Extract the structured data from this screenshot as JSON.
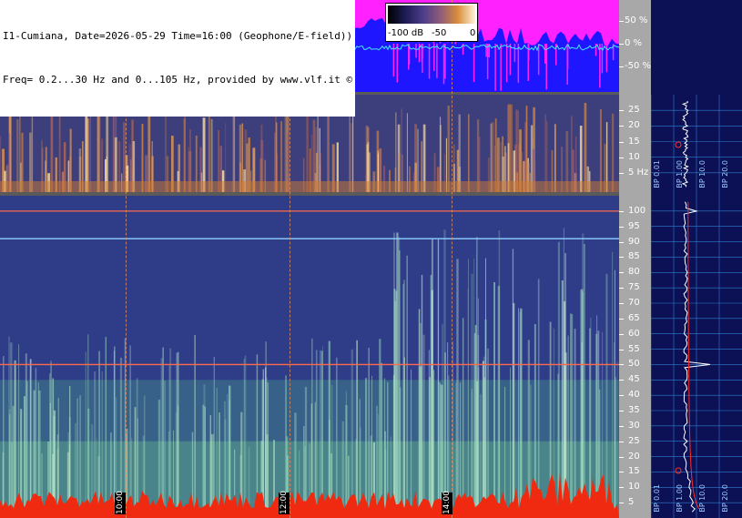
{
  "header": {
    "line1": "I1-Cumiana, Date=2026-05-29 Time=16:00 (Geophone/E-field))",
    "line2": "Freq= 0.2...30 Hz and 0...105 Hz, provided by www.vlf.it ©"
  },
  "colorbar": {
    "labels": [
      "-100 dB",
      "-50",
      "0"
    ]
  },
  "chart_data": [
    {
      "type": "line",
      "name": "waveform",
      "yticks": [
        "50 %",
        "0 %",
        "-50 %"
      ],
      "y_values": [
        50,
        0,
        -50
      ],
      "ylim": [
        -100,
        100
      ],
      "colors": {
        "background": "#1e16ff",
        "upper": "#ff22ff",
        "trace": "#46e6ff"
      }
    },
    {
      "type": "heatmap",
      "name": "low-frequency spectrogram",
      "yticks": [
        "25",
        "20",
        "15",
        "10",
        "5 Hz"
      ],
      "y_values": [
        25,
        20,
        15,
        10,
        5
      ],
      "ylim": [
        0,
        30
      ]
    },
    {
      "type": "heatmap",
      "name": "high-frequency spectrogram",
      "yticks": [
        "100",
        "95",
        "90",
        "85",
        "80",
        "75",
        "70",
        "65",
        "60",
        "55",
        "50",
        "45",
        "40",
        "35",
        "30",
        "25",
        "20",
        "15",
        "10",
        "5"
      ],
      "y_values": [
        100,
        95,
        90,
        85,
        80,
        75,
        70,
        65,
        60,
        55,
        50,
        45,
        40,
        35,
        30,
        25,
        20,
        15,
        10,
        5
      ],
      "ylim": [
        0,
        105
      ],
      "time_labels": [
        "10:00",
        "12:00",
        "14:00"
      ],
      "features": [
        {
          "freq": 50,
          "color": "#ff6a4a"
        },
        {
          "freq": 100,
          "color": "#ff6a4a"
        },
        {
          "freq": 91,
          "color": "#8fd0ff"
        }
      ]
    }
  ],
  "side_panel": {
    "bp_labels_top": [
      "BP 0.01",
      "BP 1.00",
      "BP 10.0",
      "BP 20.0"
    ],
    "bp_labels_bottom": [
      "BP 0.01",
      "BP 1.00",
      "BP 10.0",
      "BP 20.0"
    ]
  }
}
